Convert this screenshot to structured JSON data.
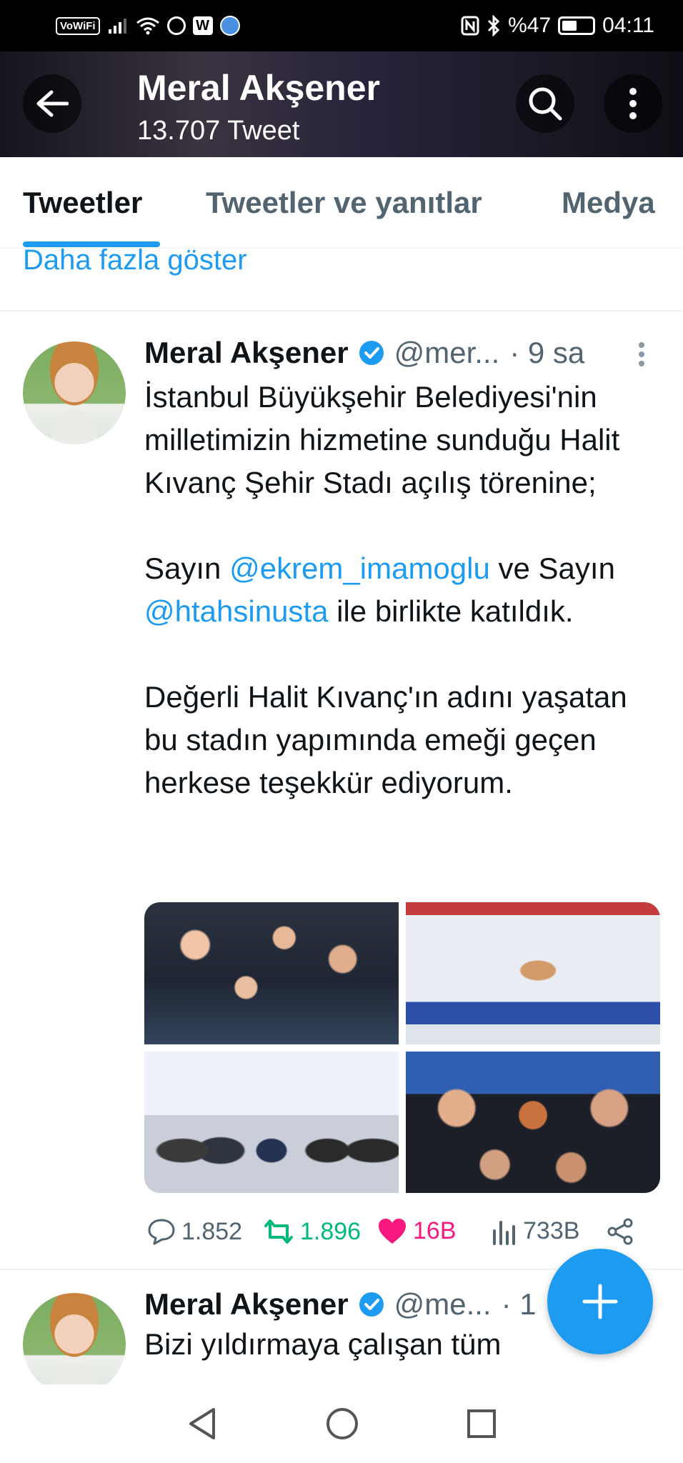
{
  "status_bar": {
    "vowifi": "VoWiFi",
    "w_icon": "W",
    "battery": "%47",
    "time": "04:11"
  },
  "header": {
    "title": "Meral Akşener",
    "subtitle": "13.707 Tweet"
  },
  "tabs": [
    {
      "label": "Tweetler"
    },
    {
      "label": "Tweetler ve yanıtlar"
    },
    {
      "label": "Medya"
    }
  ],
  "show_more": "Daha fazla göster",
  "tweet1": {
    "name": "Meral Akşener",
    "handle": "@mer...",
    "time": "· 9 sa",
    "p1": "İstanbul Büyükşehir Belediyesi'nin milletimizin hizmetine sunduğu Halit Kıvanç Şehir Stadı açılış törenine;",
    "p2_pre": "Sayın ",
    "mention1": "@ekrem_imamoglu",
    "p2_mid": " ve Sayın ",
    "mention2": "@htahsinusta",
    "p2_post": " ile birlikte katıldık.",
    "p3": "Değerli Halit Kıvanç'ın adını yaşatan bu stadın yapımında emeği geçen herkese teşekkür ediyorum.",
    "replies": "1.852",
    "retweets": "1.896",
    "likes": "16B",
    "views": "733B"
  },
  "tweet2": {
    "name": "Meral Akşener",
    "handle": "@me...",
    "time": "· 1",
    "text": "Bizi yıldırmaya çalışan tüm"
  },
  "colors": {
    "accent": "#1d9bf0",
    "retweet": "#00ba7c",
    "like": "#f91880",
    "muted": "#536471"
  }
}
